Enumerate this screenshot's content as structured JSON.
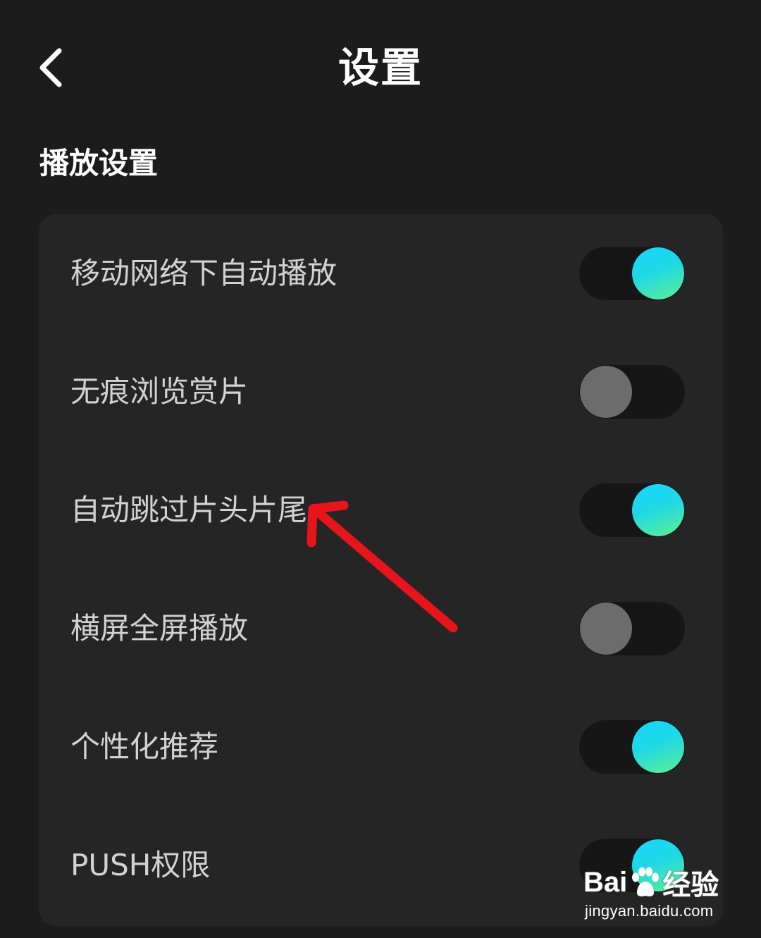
{
  "header": {
    "back_icon": "chevron-left-icon",
    "title": "设置"
  },
  "section": {
    "title": "播放设置"
  },
  "settings": [
    {
      "label": "移动网络下自动播放",
      "on": true
    },
    {
      "label": "无痕浏览赏片",
      "on": false
    },
    {
      "label": "自动跳过片头片尾",
      "on": true
    },
    {
      "label": "横屏全屏播放",
      "on": false
    },
    {
      "label": "个性化推荐",
      "on": true
    },
    {
      "label": "PUSH权限",
      "on": true
    }
  ],
  "colors": {
    "background": "#1c1c1c",
    "card": "#252525",
    "toggle_on_start": "#18d6ff",
    "toggle_on_end": "#5df08f",
    "toggle_off_knob": "#6c6c6c",
    "annotation_arrow": "#e8141b"
  },
  "watermark": {
    "logo_prefix": "Bai",
    "logo_suffix": "经验",
    "url": "jingyan.baidu.com"
  }
}
